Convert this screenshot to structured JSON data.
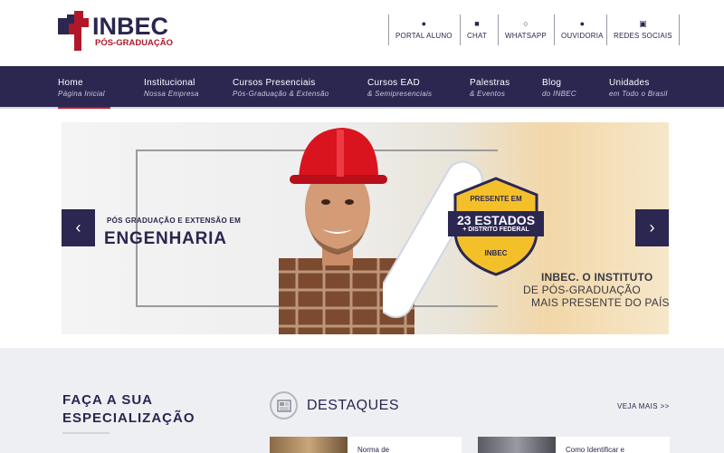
{
  "brand": {
    "name": "INBEC",
    "tagline": "PÓS-GRADUAÇÃO",
    "primary_color": "#2b2751",
    "accent_color": "#c0192c"
  },
  "quick_links": [
    {
      "label": "PORTAL ALUNO",
      "icon": "user-icon"
    },
    {
      "label": "CHAT",
      "icon": "chat-icon"
    },
    {
      "label": "WHATSAPP",
      "icon": "whatsapp-icon"
    },
    {
      "label": "OUVIDORIA",
      "icon": "globe-icon"
    },
    {
      "label": "REDES SOCIAIS",
      "icon": "share-icon"
    }
  ],
  "nav": [
    {
      "title": "Home",
      "subtitle": "Página Inicial",
      "active": true
    },
    {
      "title": "Institucional",
      "subtitle": "Nossa Empresa"
    },
    {
      "title": "Cursos Presenciais",
      "subtitle": "Pós-Graduação & Extensão"
    },
    {
      "title": "Cursos EAD",
      "subtitle": "& Semipresenciais"
    },
    {
      "title": "Palestras",
      "subtitle": "& Eventos"
    },
    {
      "title": "Blog",
      "subtitle": "do INBEC"
    },
    {
      "title": "Unidades",
      "subtitle": "em Todo o Brasil"
    }
  ],
  "hero": {
    "kicker": "PÓS GRADUAÇÃO E EXTENSÃO EM",
    "title": "ENGENHARIA",
    "badge_top": "PRESENTE EM",
    "badge_main": "23 ESTADOS",
    "badge_sub": "+ DISTRITO FEDERAL",
    "badge_brand": "INBEC",
    "line1": "INBEC. O INSTITUTO",
    "line2": "DE PÓS-GRADUAÇÃO",
    "line3": "MAIS PRESENTE DO PAÍS.",
    "prev_icon": "chevron-left-icon",
    "next_icon": "chevron-right-icon"
  },
  "spec": {
    "title_line1": "FAÇA A SUA",
    "title_line2": "ESPECIALIZAÇÃO"
  },
  "destaques": {
    "title": "DESTAQUES",
    "more": "VEJA MAIS >>",
    "icon": "newspaper-icon",
    "cards": [
      {
        "title": "Norma de"
      },
      {
        "title": "Como Identificar e"
      }
    ]
  }
}
